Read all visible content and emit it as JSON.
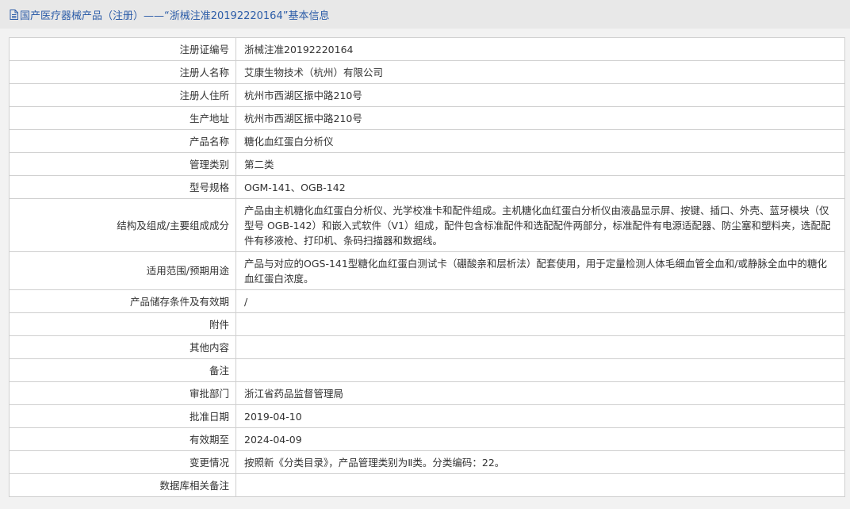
{
  "header": {
    "title": "国产医疗器械产品（注册）——“浙械注准20192220164”基本信息"
  },
  "colors": {
    "title_text": "#2d5da8",
    "header_bg": "#e8e8e8",
    "panel_bg": "#f2f2f2",
    "border": "#cfcfcf"
  },
  "rows": [
    {
      "label": "注册证编号",
      "value": "浙械注准20192220164"
    },
    {
      "label": "注册人名称",
      "value": "艾康生物技术（杭州）有限公司"
    },
    {
      "label": "注册人住所",
      "value": "杭州市西湖区振中路210号"
    },
    {
      "label": "生产地址",
      "value": "杭州市西湖区振中路210号"
    },
    {
      "label": "产品名称",
      "value": "糖化血红蛋白分析仪"
    },
    {
      "label": "管理类别",
      "value": "第二类"
    },
    {
      "label": "型号规格",
      "value": "OGM-141、OGB-142"
    },
    {
      "label": "结构及组成/主要组成成分",
      "value": "产品由主机糖化血红蛋白分析仪、光学校准卡和配件组成。主机糖化血红蛋白分析仪由液晶显示屏、按键、插口、外壳、蓝牙模块（仅型号 OGB-142）和嵌入式软件（V1）组成，配件包含标准配件和选配配件两部分，标准配件有电源适配器、防尘塞和塑料夹，选配配件有移液枪、打印机、条码扫描器和数据线。"
    },
    {
      "label": "适用范围/预期用途",
      "value": "产品与对应的OGS-141型糖化血红蛋白测试卡（硼酸亲和层析法）配套使用，用于定量检测人体毛细血管全血和/或静脉全血中的糖化血红蛋白浓度。"
    },
    {
      "label": "产品储存条件及有效期",
      "value": "/"
    },
    {
      "label": "附件",
      "value": ""
    },
    {
      "label": "其他内容",
      "value": ""
    },
    {
      "label": "备注",
      "value": ""
    },
    {
      "label": "审批部门",
      "value": "浙江省药品监督管理局"
    },
    {
      "label": "批准日期",
      "value": "2019-04-10"
    },
    {
      "label": "有效期至",
      "value": "2024-04-09"
    },
    {
      "label": "变更情况",
      "value": "按照新《分类目录》，产品管理类别为Ⅱ类。分类编码：22。"
    },
    {
      "label": "数据库相关备注",
      "value": ""
    }
  ]
}
